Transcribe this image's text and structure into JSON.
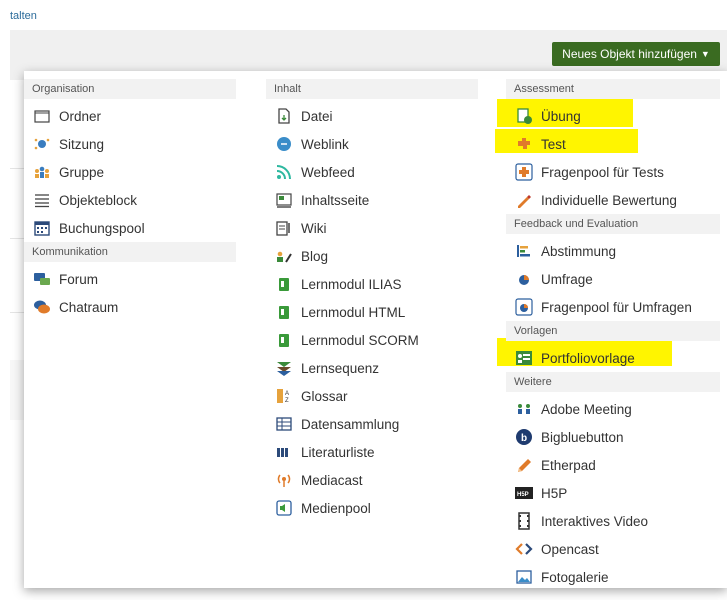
{
  "breadcrumb": "talten",
  "new_object_button": "Neues Objekt hinzufügen",
  "columns": {
    "organisation": {
      "header": "Organisation",
      "items": [
        "Ordner",
        "Sitzung",
        "Gruppe",
        "Objekteblock",
        "Buchungspool"
      ]
    },
    "kommunikation": {
      "header": "Kommunikation",
      "items": [
        "Forum",
        "Chatraum"
      ]
    },
    "inhalt": {
      "header": "Inhalt",
      "items": [
        "Datei",
        "Weblink",
        "Webfeed",
        "Inhaltsseite",
        "Wiki",
        "Blog",
        "Lernmodul ILIAS",
        "Lernmodul HTML",
        "Lernmodul SCORM",
        "Lernsequenz",
        "Glossar",
        "Datensammlung",
        "Literaturliste",
        "Mediacast",
        "Medienpool"
      ]
    },
    "assessment": {
      "header": "Assessment",
      "items": [
        "Übung",
        "Test",
        "Fragenpool für Tests",
        "Individuelle Bewertung"
      ]
    },
    "feedback": {
      "header": "Feedback und Evaluation",
      "items": [
        "Abstimmung",
        "Umfrage",
        "Fragenpool für Umfragen"
      ]
    },
    "vorlagen": {
      "header": "Vorlagen",
      "items": [
        "Portfoliovorlage"
      ]
    },
    "weitere": {
      "header": "Weitere",
      "items": [
        "Adobe Meeting",
        "Bigbluebutton",
        "Etherpad",
        "H5P",
        "Interaktives Video",
        "Opencast",
        "Fotogalerie"
      ]
    }
  },
  "colors": {
    "button_bg": "#3a6b21",
    "highlight": "#fff500",
    "header_bg": "#f2f2f2"
  }
}
